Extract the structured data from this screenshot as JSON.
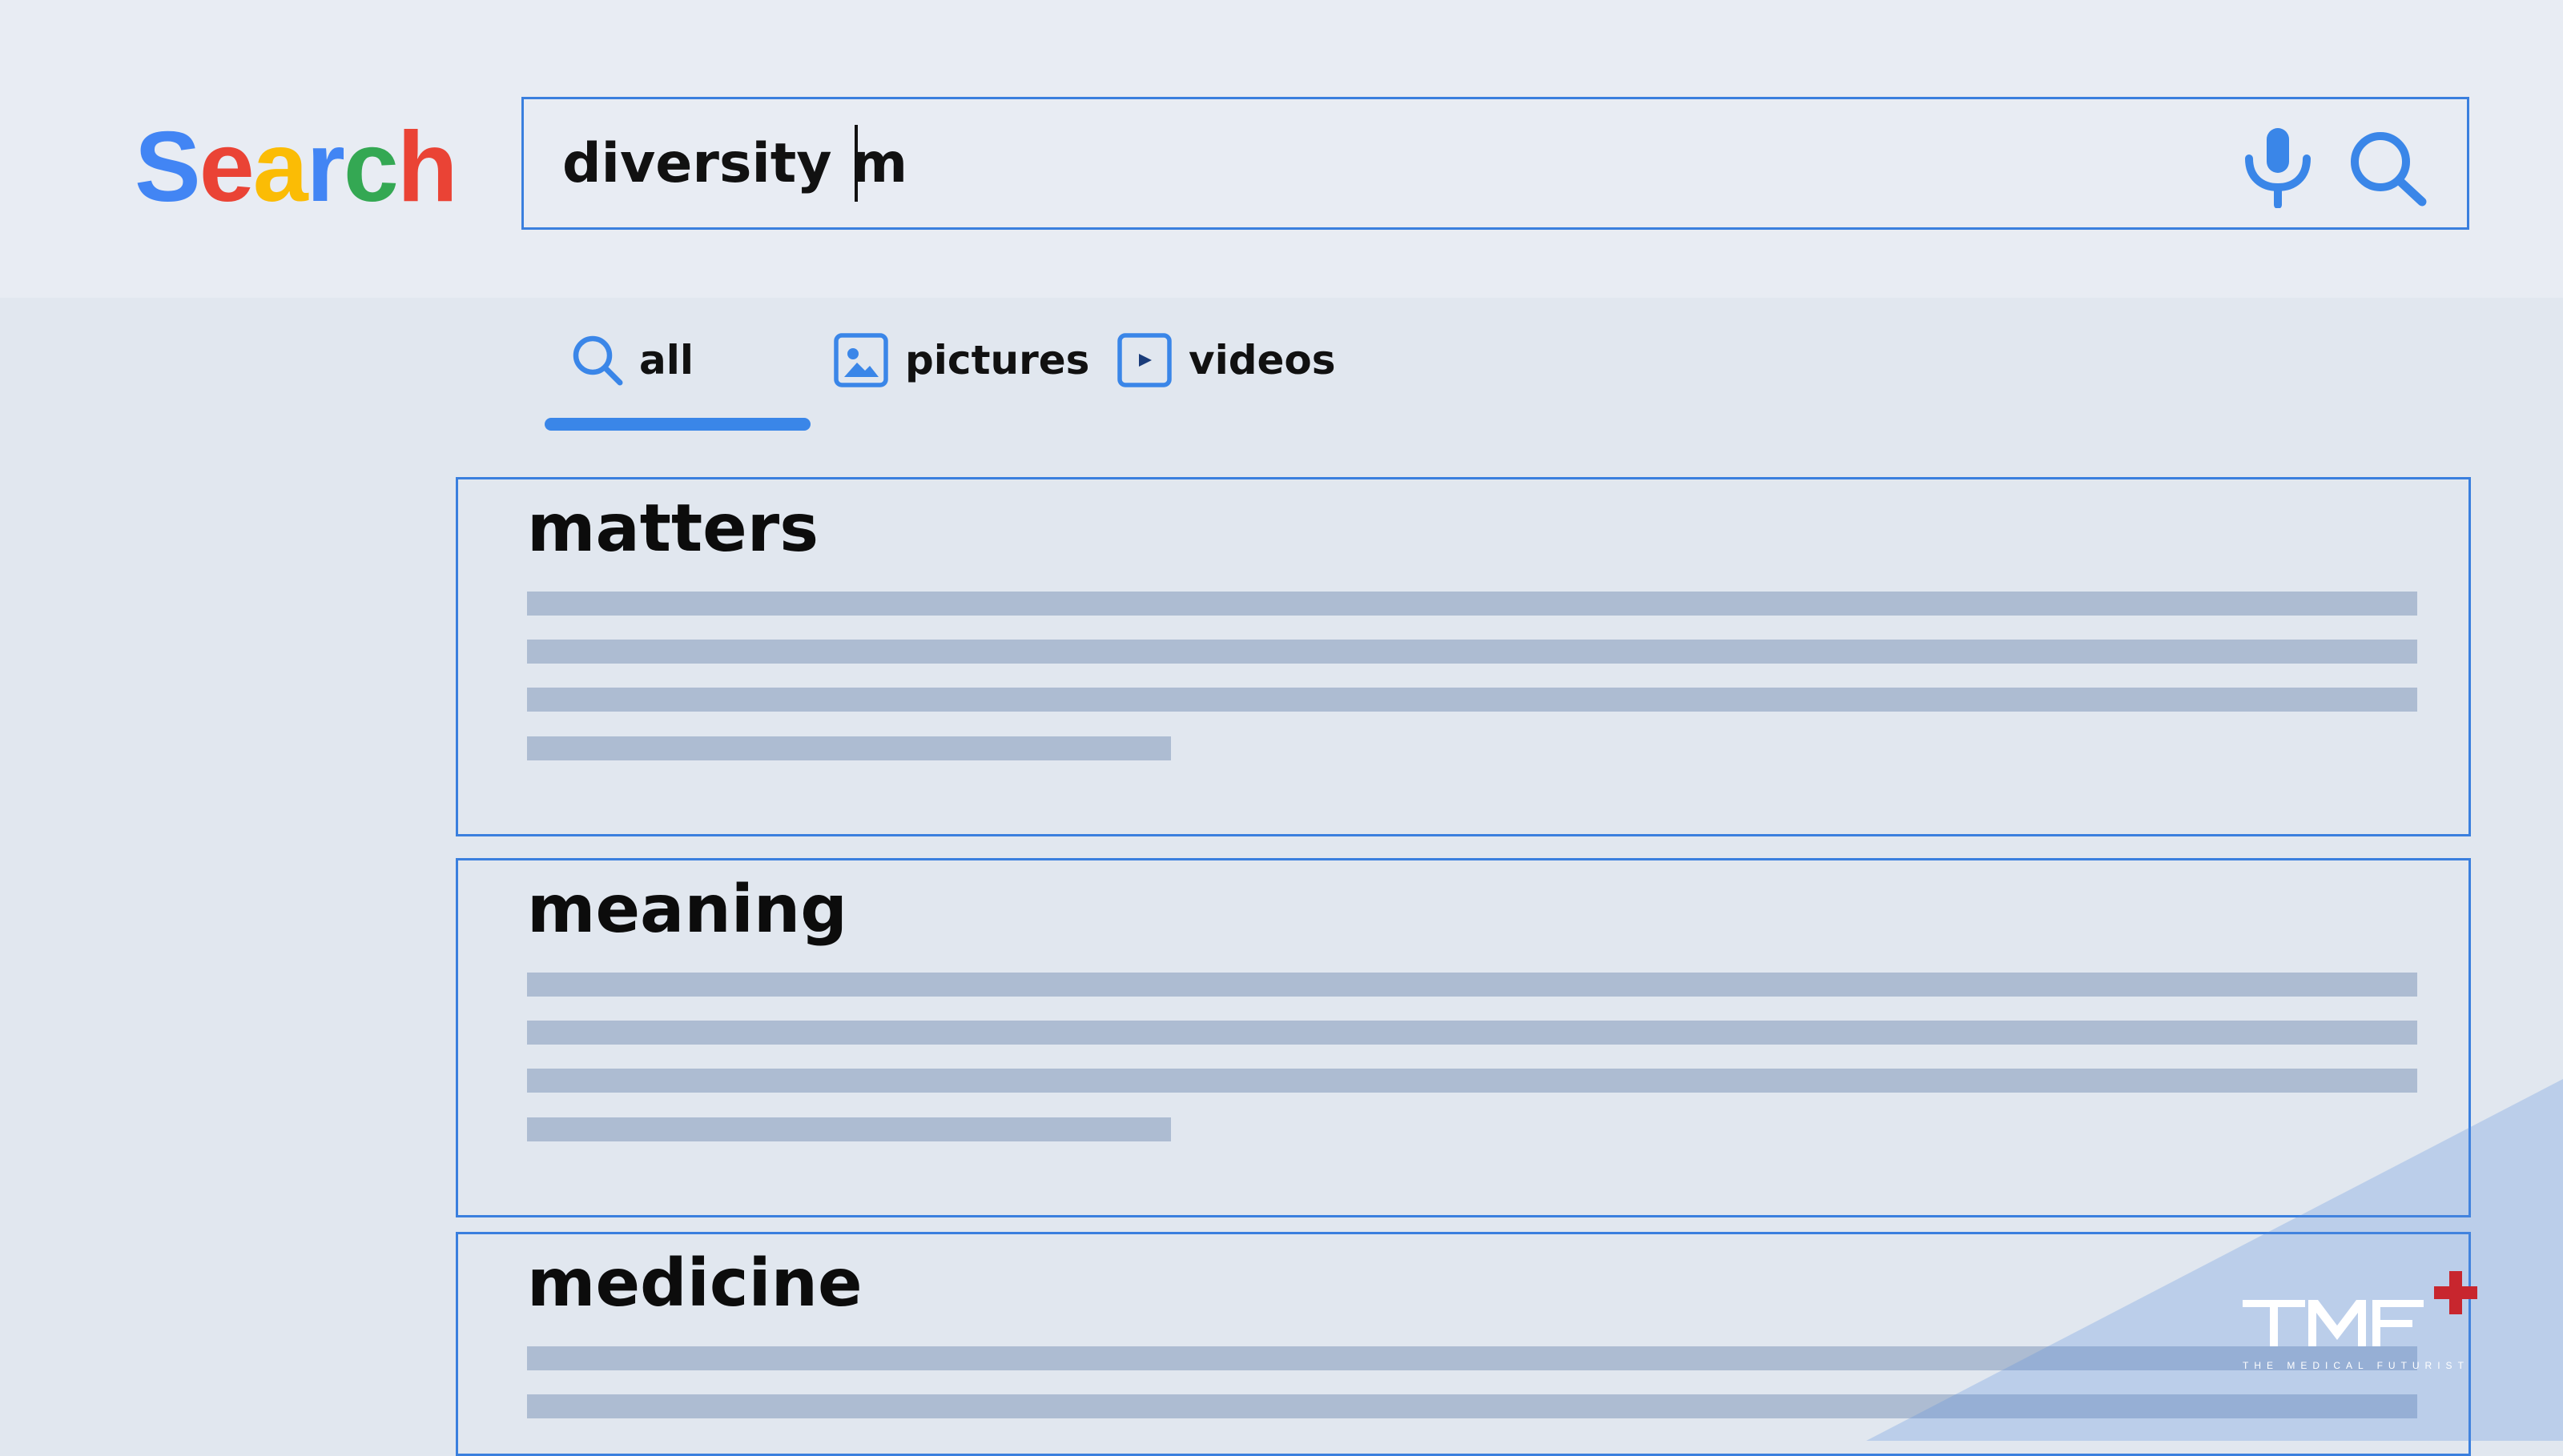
{
  "header": {
    "logo": {
      "letters": [
        {
          "char": "S",
          "color": "#4285f4"
        },
        {
          "char": "e",
          "color": "#ea4335"
        },
        {
          "char": "a",
          "color": "#fbbc05"
        },
        {
          "char": "r",
          "color": "#4285f4"
        },
        {
          "char": "c",
          "color": "#34a853"
        },
        {
          "char": "h",
          "color": "#ea4335"
        }
      ]
    },
    "search": {
      "value": "diversity m",
      "mic_icon": "microphone-icon",
      "search_icon": "magnifier-icon"
    }
  },
  "tabs": [
    {
      "label": "all",
      "icon": "magnifier-icon",
      "active": true
    },
    {
      "label": "pictures",
      "icon": "image-icon",
      "active": false
    },
    {
      "label": "videos",
      "icon": "play-icon",
      "active": false
    }
  ],
  "results": [
    {
      "title": "matters"
    },
    {
      "title": "meaning"
    },
    {
      "title": "medicine"
    }
  ],
  "watermark": {
    "logo_text": "TMF",
    "tagline": "THE MEDICAL FUTURIST"
  },
  "colors": {
    "accent": "#3a86e8",
    "border": "#3a7fde",
    "placeholder_line": "#adbcd2",
    "watermark_cross": "#c8262e",
    "page_background": "#e1e7ef",
    "header_background": "#e8ecf3"
  }
}
